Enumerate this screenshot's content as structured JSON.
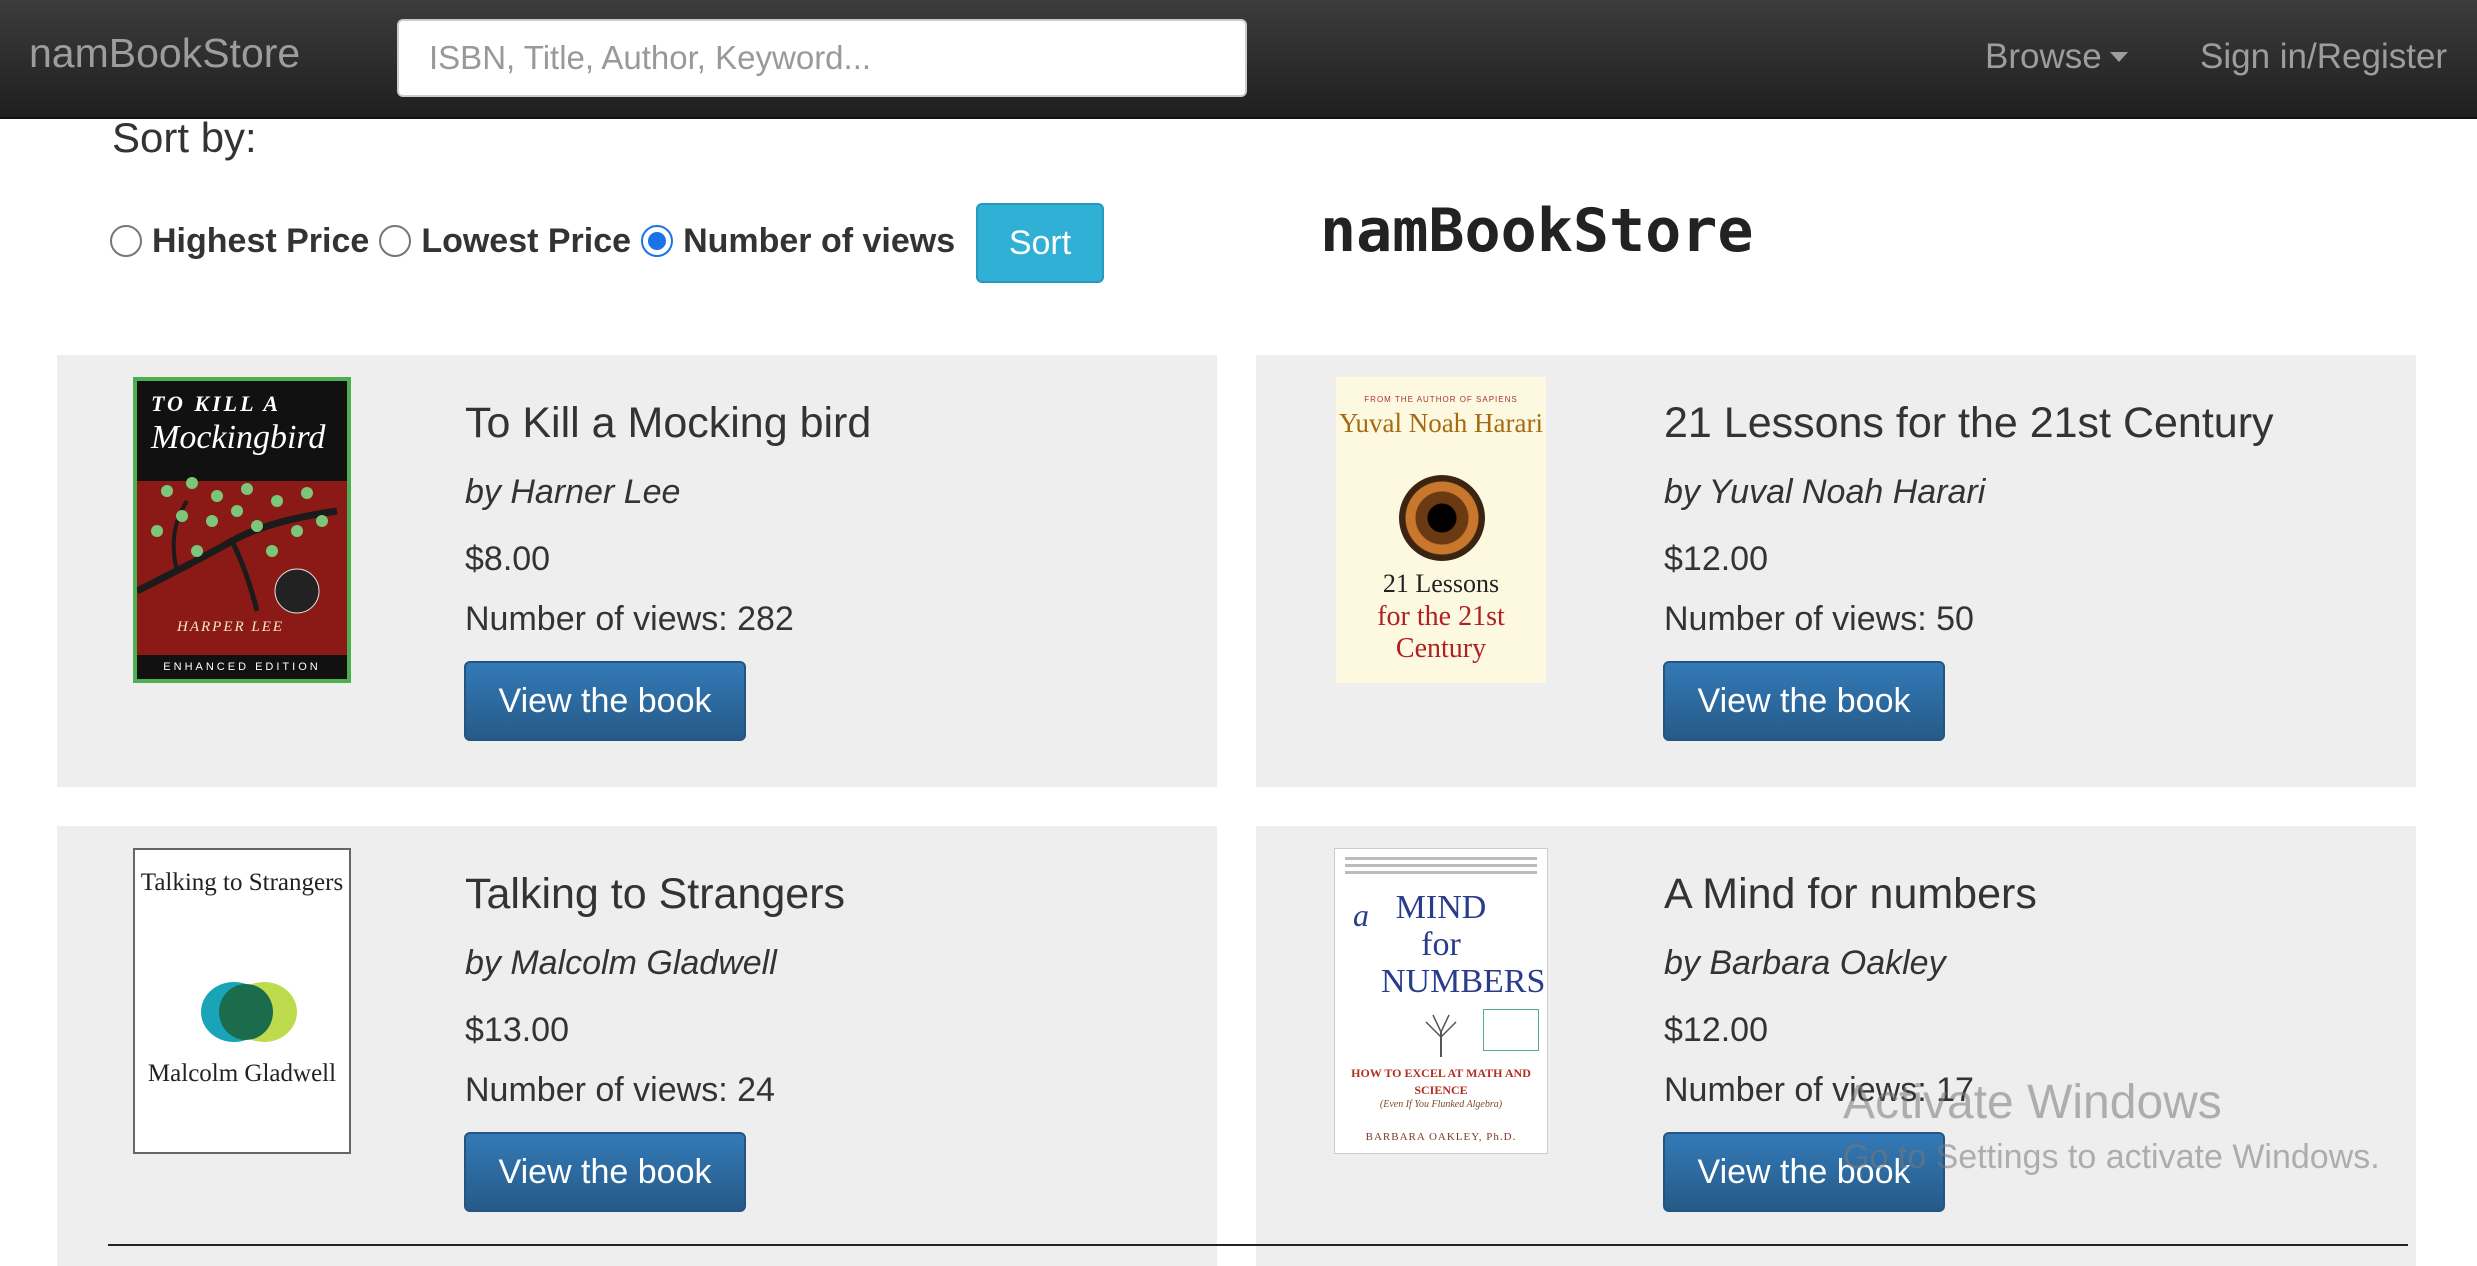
{
  "navbar": {
    "brand": "namBookStore",
    "search_placeholder": "ISBN, Title, Author, Keyword...",
    "browse_label": "Browse",
    "signin_label": "Sign in/Register"
  },
  "sort": {
    "heading": "Sort by:",
    "options": [
      {
        "label": "Highest Price",
        "checked": false
      },
      {
        "label": "Lowest Price",
        "checked": false
      },
      {
        "label": "Number of views",
        "checked": true
      }
    ],
    "button_label": "Sort"
  },
  "page_title": "namBookStore",
  "books": [
    {
      "title": "To Kill a Mocking bird",
      "author": "by Harner Lee",
      "price": "$8.00",
      "views": "Number of views: 282",
      "button": "View the book",
      "cover": {
        "line1": "TO KILL A",
        "line2": "Mockingbird",
        "author": "HARPER LEE",
        "footer": "ENHANCED EDITION"
      }
    },
    {
      "title": "21 Lessons for the 21st Century",
      "author": "by Yuval Noah Harari",
      "price": "$12.00",
      "views": "Number of views: 50",
      "button": "View the book",
      "cover": {
        "top": "FROM THE AUTHOR OF SAPIENS",
        "name": "Yuval Noah Harari",
        "line1": "21 Lessons",
        "line2": "for the 21st Century"
      }
    },
    {
      "title": "Talking to Strangers",
      "author": "by Malcolm Gladwell",
      "price": "$13.00",
      "views": "Number of views: 24",
      "button": "View the book",
      "cover": {
        "title": "Talking to Strangers",
        "author": "Malcolm Gladwell"
      }
    },
    {
      "title": "A Mind for numbers",
      "author": "by Barbara Oakley",
      "price": "$12.00",
      "views": "Number of views: 17",
      "button": "View the book",
      "cover": {
        "a": "a",
        "title": "MIND for NUMBERS",
        "sub": "HOW TO EXCEL AT MATH AND SCIENCE",
        "sub2": "(Even If You Flunked Algebra)",
        "author": "BARBARA OAKLEY, Ph.D."
      }
    }
  ],
  "watermark": {
    "line1": "Activate Windows",
    "line2": "Go to Settings to activate Windows."
  }
}
